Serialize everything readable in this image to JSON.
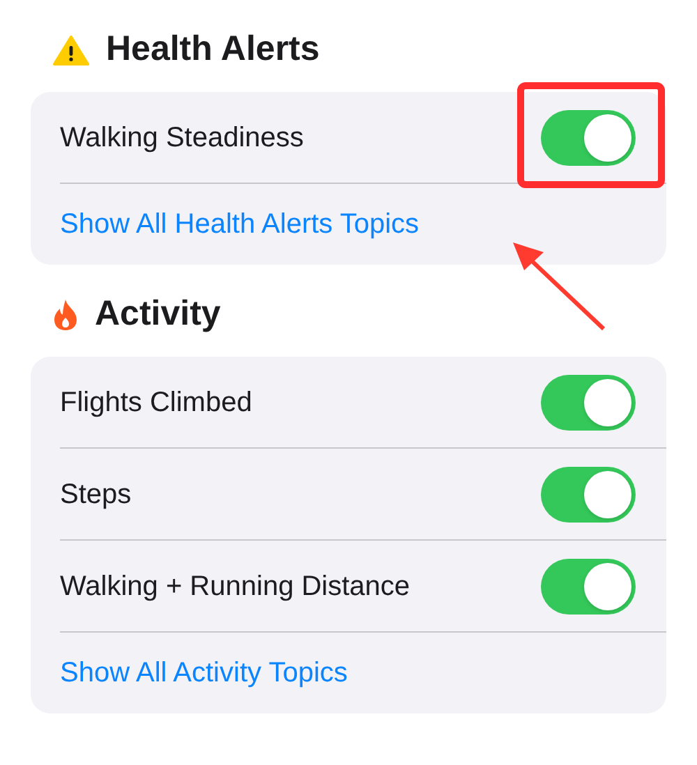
{
  "sections": [
    {
      "title": "Health Alerts",
      "items": [
        {
          "label": "Walking Steadiness",
          "on": true,
          "highlighted": true
        }
      ],
      "link": {
        "label": "Show All Health Alerts Topics",
        "arrow": true
      }
    },
    {
      "title": "Activity",
      "items": [
        {
          "label": "Flights Climbed",
          "on": true,
          "highlighted": false
        },
        {
          "label": "Steps",
          "on": true,
          "highlighted": false
        },
        {
          "label": "Walking + Running Distance",
          "on": true,
          "highlighted": false
        }
      ],
      "link": {
        "label": "Show All Activity Topics",
        "arrow": false
      }
    }
  ]
}
